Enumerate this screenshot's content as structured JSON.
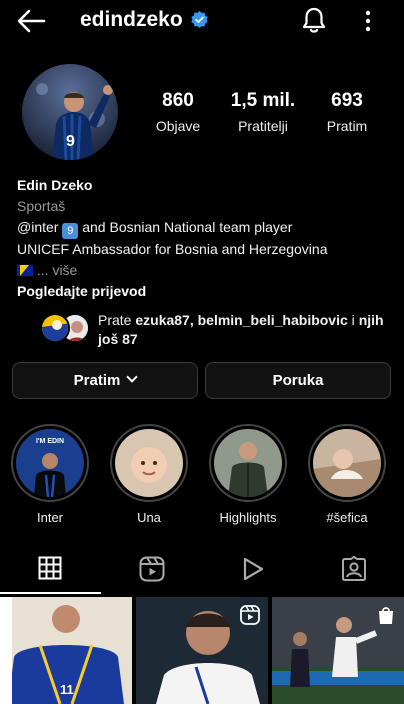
{
  "header": {
    "username": "edindzeko",
    "verified_icon": "verified-badge-icon",
    "back_icon": "back-arrow-icon",
    "bell_icon": "notification-bell-icon",
    "more_icon": "more-vertical-icon"
  },
  "stats": [
    {
      "value": "860",
      "label": "Objave"
    },
    {
      "value": "1,5 mil.",
      "label": "Pratitelji"
    },
    {
      "value": "693",
      "label": "Pratim"
    }
  ],
  "bio": {
    "name": "Edin Dzeko",
    "category": "Sportaš",
    "line1_prefix": "@inter",
    "line1_badge": "9",
    "line1_suffix": "and Bosnian National team player",
    "line2": "UNICEF Ambassador for Bosnia and Herzegovina",
    "more": "... više",
    "translate": "Pogledajte prijevod"
  },
  "followed_by": {
    "prefix": "Prate",
    "names": "ezuka87, belmin_beli_habibovic",
    "connector": "i",
    "rest": "njih još 87"
  },
  "buttons": {
    "following": "Pratim",
    "message": "Poruka"
  },
  "highlights": [
    {
      "label": "Inter"
    },
    {
      "label": "Una"
    },
    {
      "label": "Highlights"
    },
    {
      "label": "#šefica"
    }
  ],
  "highlight_inner_text": "I'M EDIN",
  "tabs": [
    {
      "name": "grid-icon"
    },
    {
      "name": "reels-icon"
    },
    {
      "name": "play-icon"
    },
    {
      "name": "tagged-icon"
    }
  ],
  "grid_jersey_number": "11",
  "colors": {
    "background": "#000000",
    "verified": "#3897f0",
    "button_bg": "#121212",
    "button_border": "#3a3a3a"
  }
}
